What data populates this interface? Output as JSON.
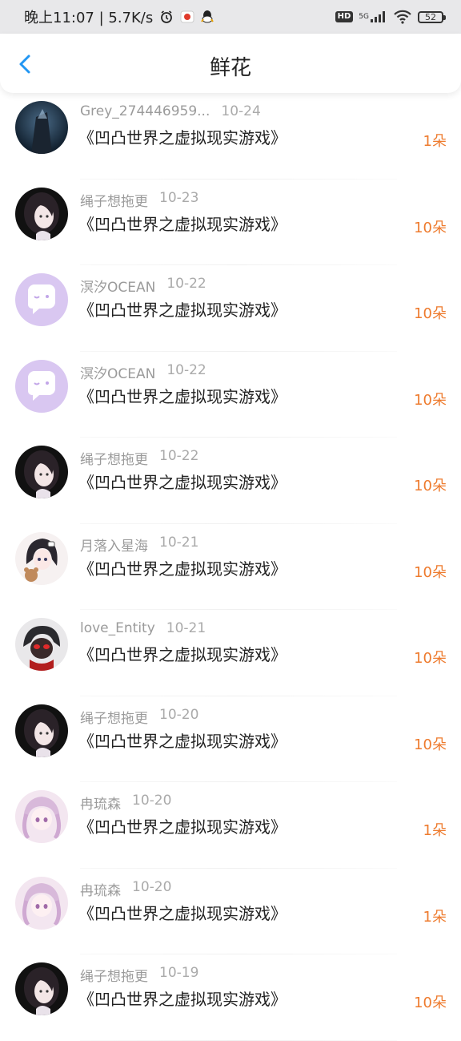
{
  "statusbar": {
    "time_speed": "晚上11:07 | 5.7K/s",
    "hd": "HD",
    "network": "5G",
    "battery": "52"
  },
  "header": {
    "title": "鲜花"
  },
  "colors": {
    "accent": "#ee7b2e",
    "back": "#2196f3"
  },
  "items": [
    {
      "user": "Grey_274446959...",
      "date": "10-24",
      "book": "《凹凸世界之虚拟现实游戏》",
      "count": "1朵",
      "avatar": "dark-portrait"
    },
    {
      "user": "绳子想拖更",
      "date": "10-23",
      "book": "《凹凸世界之虚拟现实游戏》",
      "count": "10朵",
      "avatar": "girl-dark-hair"
    },
    {
      "user": "溟汐OCEAN",
      "date": "10-22",
      "book": "《凹凸世界之虚拟现实游戏》",
      "count": "10朵",
      "avatar": "default-purple"
    },
    {
      "user": "溟汐OCEAN",
      "date": "10-22",
      "book": "《凹凸世界之虚拟现实游戏》",
      "count": "10朵",
      "avatar": "default-purple"
    },
    {
      "user": "绳子想拖更",
      "date": "10-22",
      "book": "《凹凸世界之虚拟现实游戏》",
      "count": "10朵",
      "avatar": "girl-dark-hair"
    },
    {
      "user": "月落入星海",
      "date": "10-21",
      "book": "《凹凸世界之虚拟现实游戏》",
      "count": "10朵",
      "avatar": "anime-girl-bear"
    },
    {
      "user": "love_Entity",
      "date": "10-21",
      "book": "《凹凸世界之虚拟现实游戏》",
      "count": "10朵",
      "avatar": "anime-red-eyes"
    },
    {
      "user": "绳子想拖更",
      "date": "10-20",
      "book": "《凹凸世界之虚拟现实游戏》",
      "count": "10朵",
      "avatar": "girl-dark-hair"
    },
    {
      "user": "冉琉森",
      "date": "10-20",
      "book": "《凹凸世界之虚拟现实游戏》",
      "count": "1朵",
      "avatar": "anime-pink-girl"
    },
    {
      "user": "冉琉森",
      "date": "10-20",
      "book": "《凹凸世界之虚拟现实游戏》",
      "count": "1朵",
      "avatar": "anime-pink-girl"
    },
    {
      "user": "绳子想拖更",
      "date": "10-19",
      "book": "《凹凸世界之虚拟现实游戏》",
      "count": "10朵",
      "avatar": "girl-dark-hair"
    }
  ]
}
